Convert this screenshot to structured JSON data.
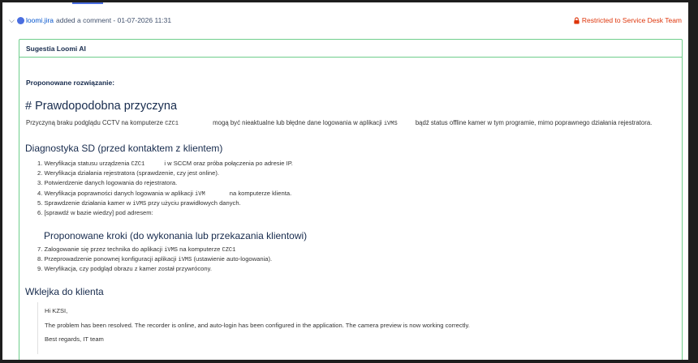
{
  "comment": {
    "author": "loomi.jira",
    "action": "added a comment",
    "timestamp": "01-07-2026 11:31",
    "restriction": "Restricted to Service Desk Team"
  },
  "panel": {
    "title": "Sugestia Loomi AI",
    "proposed_label": "Proponowane rozwiązanie:",
    "cause_heading": "# Prawdopodobna przyczyna",
    "cause_text": {
      "a": "Przyczyną braku podglądu CCTV na komputerze",
      "code1": "CZC1",
      "b": "mogą być nieaktualne lub błędne dane logowania w aplikacji",
      "code2": "iVMS",
      "c": "bądź status offline kamer w tym programie, mimo poprawnego działania rejestratora."
    },
    "diag_heading": "Diagnostyka SD (przed kontaktem z klientem)",
    "diag_items": {
      "i1": {
        "a": "1. Weryfikacja statusu urządzenia",
        "code": "CZC1",
        "b": "i w SCCM oraz próba połączenia po adresie IP."
      },
      "i2": "2. Weryfikacja działania rejestratora (sprawdzenie, czy jest online).",
      "i3": "3. Potwierdzenie danych logowania do rejestratora.",
      "i4": {
        "a": "4. Weryfikacja poprawności danych logowania w aplikacji",
        "code": "iVM",
        "b": "na komputerze klienta."
      },
      "i5": {
        "a": "5. Sprawdzenie działania kamer w",
        "code": "iVMS",
        "b": "przy użyciu prawidłowych danych."
      },
      "i6": "6. [sprawdź w bazie wiedzy] pod adresem:"
    },
    "steps_heading": "Proponowane kroki (do wykonania lub przekazania klientowi)",
    "step_items": {
      "i7": {
        "a": "7. Zalogowanie się przez technika do aplikacji",
        "code": "iVMS",
        "b": "na komputerze",
        "code2": "CZC1"
      },
      "i8": {
        "a": "8. Przeprowadzenie ponownej konfiguracji aplikacji",
        "code": "iVMS",
        "b": "(ustawienie auto-logowania)."
      },
      "i9": "9. Weryfikacja, czy podgląd obrazu z kamer został przywrócony."
    },
    "paste_heading": "Wklejka do klienta",
    "paste": {
      "greeting": "Hi KZSI,",
      "body": "The problem has been resolved. The recorder is online, and auto-login has been configured in the application. The camera preview is now working correctly.",
      "signoff": "Best regards, IT team"
    }
  },
  "colors": {
    "accent": "#0052cc",
    "restricted": "#de350b",
    "panel_border": "#6fce8c"
  }
}
